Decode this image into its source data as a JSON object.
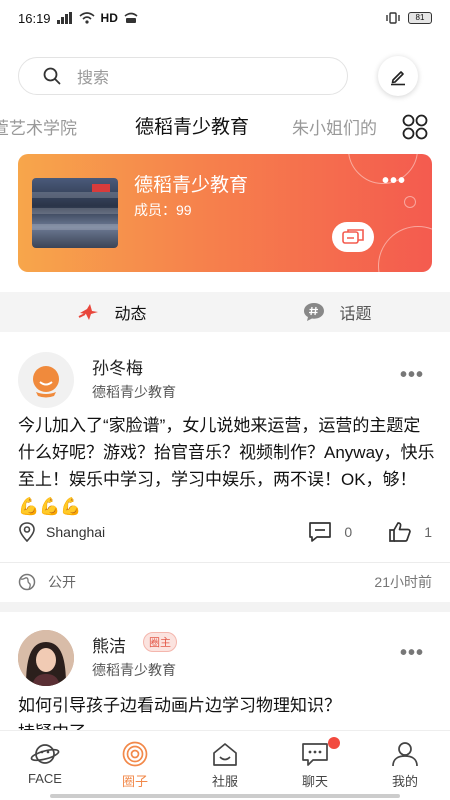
{
  "status_bar": {
    "time": "16:19",
    "network": "HD",
    "battery": "81"
  },
  "search": {
    "placeholder": "搜索"
  },
  "tabs": [
    {
      "label": "萱艺术学院",
      "active": false
    },
    {
      "label": "德稻青少教育",
      "active": true
    },
    {
      "label": "朱小姐们的",
      "active": false
    }
  ],
  "banner": {
    "title": "德稻青少教育",
    "members": "成员：99",
    "more_icon": "more-dots-icon",
    "chat_icon": "group-chat-icon"
  },
  "section_tabs": [
    {
      "label": "动态",
      "icon": "dynamic-icon",
      "active": true
    },
    {
      "label": "话题",
      "icon": "topic-hash-icon",
      "active": false
    }
  ],
  "posts": [
    {
      "author": "孙冬梅",
      "group": "德稻青少教育",
      "badge": "",
      "text": "今儿加入了“家脸谱”，女儿说她来运营，运营的主题定什么好呢？游戏？抬官音乐？视频制作？Anyway，快乐至上！娱乐中学习，学习中娱乐，两不误！OK，够！",
      "emoji": "💪💪💪",
      "location": "Shanghai",
      "comments": "0",
      "likes": "1",
      "visibility": "公开",
      "time": "21小时前"
    },
    {
      "author": "熊洁",
      "group": "德稻青少教育",
      "badge": "圈主",
      "text": "如何引导孩子边看动画片边学习物理知识？",
      "text_line2": "持疑中了"
    }
  ],
  "bottom_nav": [
    {
      "label": "FACE",
      "icon": "face-planet-icon",
      "active": false
    },
    {
      "label": "圈子",
      "icon": "circle-swirl-icon",
      "active": true
    },
    {
      "label": "社服",
      "icon": "service-house-icon",
      "active": false
    },
    {
      "label": "聊天",
      "icon": "chat-bubble-icon",
      "active": false,
      "badge": true
    },
    {
      "label": "我的",
      "icon": "profile-person-icon",
      "active": false
    }
  ],
  "colors": {
    "accent": "#f2894a",
    "banner_start": "#f7a64b",
    "banner_end": "#f45b4f",
    "badge_red": "#f24a3f"
  }
}
